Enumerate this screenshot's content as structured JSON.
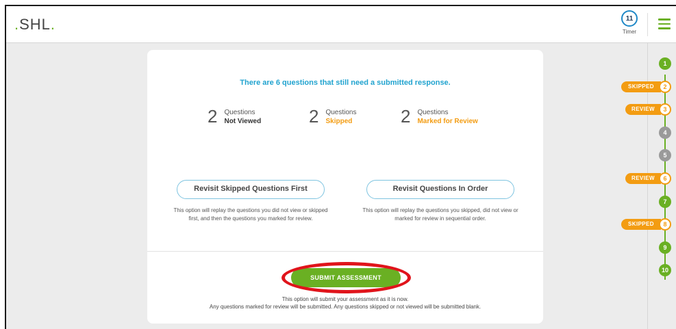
{
  "header": {
    "logo_text": "SHL",
    "logo_prefix": ".",
    "logo_suffix": ".",
    "timer_value": "11",
    "timer_label": "Timer"
  },
  "summary": {
    "headline": "There are 6 questions that still need a submitted response.",
    "stats": [
      {
        "count": "2",
        "label": "Questions",
        "status": "Not Viewed"
      },
      {
        "count": "2",
        "label": "Questions",
        "status": "Skipped"
      },
      {
        "count": "2",
        "label": "Questions",
        "status": "Marked for Review"
      }
    ]
  },
  "options": {
    "skipped_first": {
      "label": "Revisit Skipped Questions First",
      "description": "This option will replay the questions you did not view or skipped first, and then the questions you marked for review."
    },
    "in_order": {
      "label": "Revisit Questions In Order",
      "description": "This option will replay the questions you skipped, did not view or marked for review in sequential order."
    }
  },
  "submit": {
    "label": "SUBMIT ASSESSMENT",
    "description_line1": "This option will submit your assessment as it is now.",
    "description_line2": "Any questions marked for review will be submitted. Any questions skipped or not viewed will be submitted blank."
  },
  "progress": {
    "questions": [
      {
        "number": "1",
        "state": "answered",
        "tag": ""
      },
      {
        "number": "2",
        "state": "skipped",
        "tag": "SKIPPED"
      },
      {
        "number": "3",
        "state": "review",
        "tag": "REVIEW"
      },
      {
        "number": "4",
        "state": "not-viewed",
        "tag": ""
      },
      {
        "number": "5",
        "state": "not-viewed",
        "tag": ""
      },
      {
        "number": "6",
        "state": "review",
        "tag": "REVIEW"
      },
      {
        "number": "7",
        "state": "answered",
        "tag": ""
      },
      {
        "number": "8",
        "state": "skipped",
        "tag": "SKIPPED"
      },
      {
        "number": "9",
        "state": "answered",
        "tag": ""
      },
      {
        "number": "10",
        "state": "answered",
        "tag": ""
      }
    ]
  },
  "colors": {
    "brand_green": "#6ab023",
    "accent_blue": "#21a3cf",
    "warning_orange": "#f39c12",
    "neutral_gray": "#9a9a9a",
    "highlight_red": "#e0141b"
  }
}
